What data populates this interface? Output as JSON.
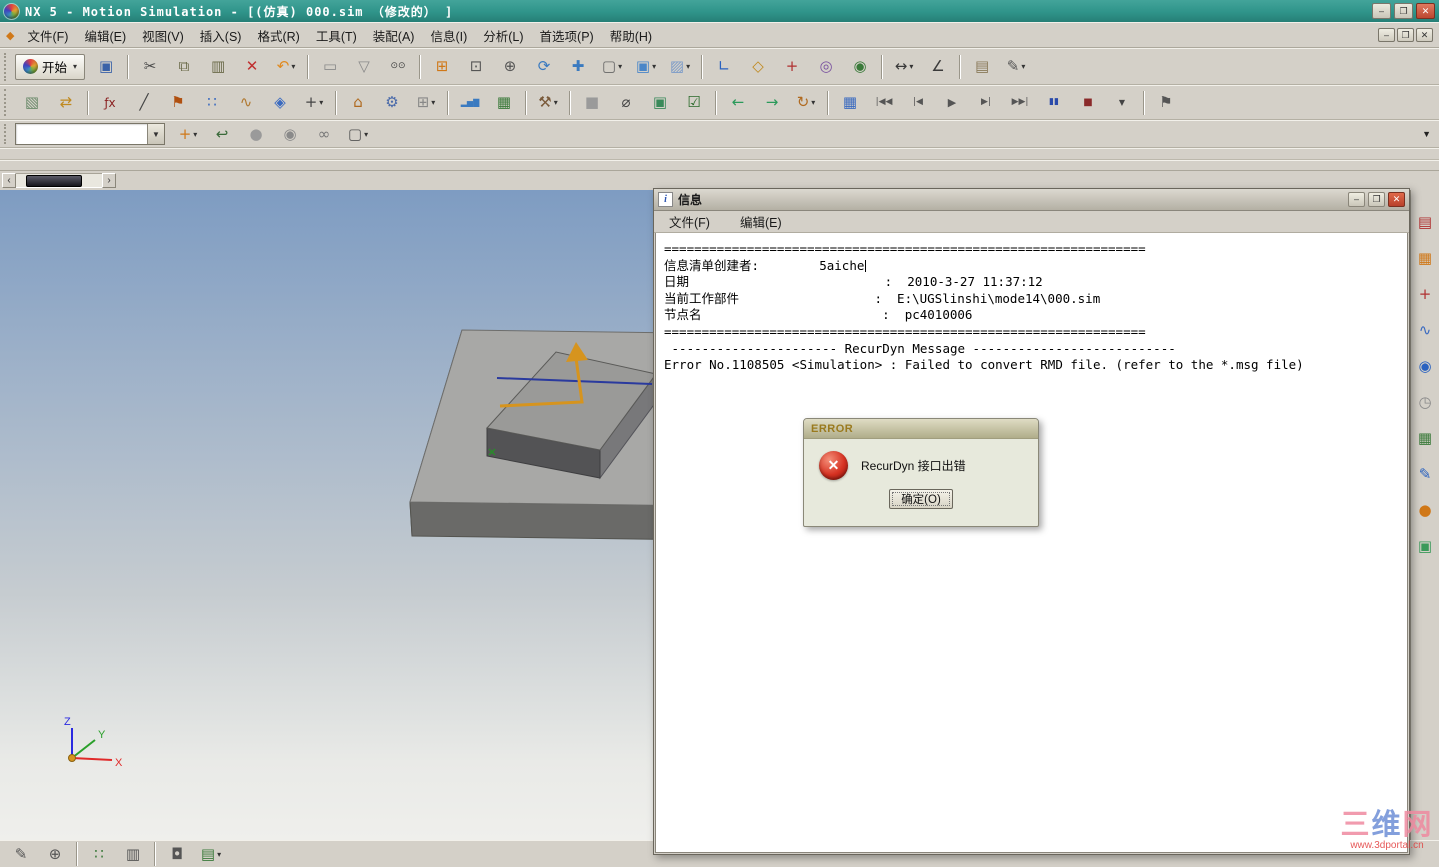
{
  "window": {
    "title": "NX 5 - Motion Simulation - [(仿真) 000.sim （修改的） ]",
    "minimize": "–",
    "restore": "❐",
    "close": "✕"
  },
  "menubar": {
    "items": [
      "文件(F)",
      "编辑(E)",
      "视图(V)",
      "插入(S)",
      "格式(R)",
      "工具(T)",
      "装配(A)",
      "信息(I)",
      "分析(L)",
      "首选项(P)",
      "帮助(H)"
    ],
    "minimize": "–",
    "restore": "❐",
    "close": "✕"
  },
  "toolbar1": {
    "start_label": "开始",
    "dropdown_glyph": "▾",
    "icons": [
      {
        "name": "save-icon",
        "glyph": "▣",
        "color": "#3a62a8"
      },
      {
        "sep": true
      },
      {
        "name": "cut-icon",
        "glyph": "✂",
        "color": "#4a4a4a"
      },
      {
        "name": "copy-icon",
        "glyph": "⧉",
        "color": "#6b6b4a"
      },
      {
        "name": "paste-icon",
        "glyph": "▥",
        "color": "#6b6b4a"
      },
      {
        "name": "delete-icon",
        "glyph": "✕",
        "color": "#c03030"
      },
      {
        "name": "undo-icon",
        "glyph": "↶",
        "color": "#e08a20",
        "arrow": true
      },
      {
        "sep": true
      },
      {
        "name": "sheet-icon",
        "glyph": "▭",
        "color": "#8a8a8a"
      },
      {
        "name": "filter-icon",
        "glyph": "▽",
        "color": "#8a8a8a"
      },
      {
        "name": "glasses-icon",
        "glyph": "⊙⊙",
        "color": "#444444",
        "size": 9
      },
      {
        "sep": true
      },
      {
        "name": "fit-view-icon",
        "glyph": "⊞",
        "color": "#d07818"
      },
      {
        "name": "zoom-window-icon",
        "glyph": "⊡",
        "color": "#555555"
      },
      {
        "name": "zoom-icon",
        "glyph": "⊕",
        "color": "#555555"
      },
      {
        "name": "rotate-view-icon",
        "glyph": "⟳",
        "color": "#3a7ac0"
      },
      {
        "name": "pan-icon",
        "glyph": "✚",
        "color": "#3a7ac0"
      },
      {
        "name": "wireframe-icon",
        "glyph": "▢",
        "color": "#666666",
        "arrow": true
      },
      {
        "name": "shaded-view-icon",
        "glyph": "▣",
        "color": "#4a86c8",
        "arrow": true
      },
      {
        "name": "rendered-view-icon",
        "glyph": "▨",
        "color": "#7a9ac8",
        "arrow": true
      },
      {
        "sep": true
      },
      {
        "name": "csys-icon",
        "glyph": "∟",
        "color": "#2a62c0"
      },
      {
        "name": "datum-plane-icon",
        "glyph": "◇",
        "color": "#c08a20"
      },
      {
        "name": "point-constructor-icon",
        "glyph": "+",
        "color": "#b03030"
      },
      {
        "name": "orient-view-icon",
        "glyph": "◎",
        "color": "#7a52a0"
      },
      {
        "name": "show-hide-icon",
        "glyph": "◉",
        "color": "#3a7a3a"
      },
      {
        "sep": true
      },
      {
        "name": "measure-distance-icon",
        "glyph": "↔",
        "color": "#3a3a3a",
        "arrow": true
      },
      {
        "name": "measure-angle-icon",
        "glyph": "∠",
        "color": "#3a3a3a"
      },
      {
        "sep": true
      },
      {
        "name": "ruler-icon",
        "glyph": "▤",
        "color": "#8a7a5a"
      },
      {
        "name": "annotation-icon",
        "glyph": "✎",
        "color": "#555555",
        "arrow": true
      }
    ]
  },
  "toolbar2": {
    "icons": [
      {
        "name": "part-window-icon",
        "glyph": "▧",
        "color": "#6a8a6a"
      },
      {
        "name": "transform-icon",
        "glyph": "⇄",
        "color": "#c08a20"
      },
      {
        "sep": true
      },
      {
        "name": "expression-icon",
        "glyph": "ƒx",
        "color": "#8a2020",
        "size": 12
      },
      {
        "name": "line-icon",
        "glyph": "╱",
        "color": "#444444"
      },
      {
        "name": "flag-icon",
        "glyph": "⚑",
        "color": "#b05010"
      },
      {
        "name": "pattern-icon",
        "glyph": "∷",
        "color": "#3a6ac0"
      },
      {
        "name": "spring-icon",
        "glyph": "∿",
        "color": "#b07830"
      },
      {
        "name": "marker-icon",
        "glyph": "◈",
        "color": "#3a6ac0"
      },
      {
        "name": "point-icon",
        "glyph": "+",
        "color": "#444444",
        "arrow": true
      },
      {
        "sep": true
      },
      {
        "name": "home-icon",
        "glyph": "⌂",
        "color": "#b06a20"
      },
      {
        "name": "mechanism-icon",
        "glyph": "⚙",
        "color": "#4a6aaa"
      },
      {
        "name": "window-icon",
        "glyph": "⊞",
        "color": "#888888",
        "arrow": true
      },
      {
        "sep": true
      },
      {
        "name": "graph-icon",
        "glyph": "▂▅▇",
        "color": "#3a7ac0",
        "size": 8
      },
      {
        "name": "spreadsheet-icon",
        "glyph": "▦",
        "color": "#3a7a3a"
      },
      {
        "sep": true
      },
      {
        "name": "tools-icon",
        "glyph": "⚒",
        "color": "#7a5a3a",
        "arrow": true
      },
      {
        "sep": true
      },
      {
        "name": "solid-icon",
        "glyph": "■",
        "color": "#9a9a9a"
      },
      {
        "name": "locate-icon",
        "glyph": "⌀",
        "color": "#444444"
      },
      {
        "name": "image-icon",
        "glyph": "▣",
        "color": "#3a8a5a"
      },
      {
        "name": "grid-check-icon",
        "glyph": "☑",
        "color": "#2a6a2a"
      },
      {
        "sep": true
      },
      {
        "name": "back-icon",
        "glyph": "←",
        "color": "#2a9a5a"
      },
      {
        "name": "forward-icon",
        "glyph": "→",
        "color": "#2a9a5a"
      },
      {
        "name": "reorient-icon",
        "glyph": "↻",
        "color": "#b06a20",
        "arrow": true
      },
      {
        "sep": true
      },
      {
        "name": "solve-icon",
        "glyph": "▦",
        "color": "#3a6ac0"
      },
      {
        "name": "to-start-icon",
        "glyph": "|◀◀",
        "color": "#555555",
        "size": 9
      },
      {
        "name": "step-back-icon",
        "glyph": "|◀",
        "color": "#555555",
        "size": 9
      },
      {
        "name": "play-icon",
        "glyph": "▶",
        "color": "#555555",
        "size": 11
      },
      {
        "name": "step-forward-icon",
        "glyph": "▶|",
        "color": "#555555",
        "size": 9
      },
      {
        "name": "to-end-icon",
        "glyph": "▶▶|",
        "color": "#555555",
        "size": 9
      },
      {
        "name": "pause-icon",
        "glyph": "▮▮",
        "color": "#2a4aaa",
        "size": 9
      },
      {
        "name": "stop-icon",
        "glyph": "■",
        "color": "#8a2a2a",
        "size": 10
      },
      {
        "name": "speed-dropdown-icon",
        "glyph": "▼",
        "color": "#444444",
        "size": 8
      },
      {
        "sep": true
      },
      {
        "name": "finish-flag-icon",
        "glyph": "⚑",
        "color": "#555555"
      }
    ]
  },
  "selection_bar": {
    "filter_value": "",
    "combo_arrow": "▼",
    "overflow_glyph": "▼",
    "icons": [
      {
        "name": "snap-add-icon",
        "glyph": "+",
        "color": "#d07818",
        "arrow": true
      },
      {
        "name": "undo-selection-icon",
        "glyph": "↩",
        "color": "#3a6a3a"
      },
      {
        "name": "ball-icon",
        "glyph": "●",
        "color": "#9a9a9a"
      },
      {
        "name": "ball-arrow-icon",
        "glyph": "◉",
        "color": "#8a8a8a"
      },
      {
        "name": "chain-icon",
        "glyph": "∞",
        "color": "#777777"
      },
      {
        "name": "rect-select-icon",
        "glyph": "▢",
        "color": "#555555",
        "arrow": true
      }
    ]
  },
  "right_toolbar": {
    "icons": [
      {
        "name": "simulation-navigator-icon",
        "glyph": "▤",
        "color": "#b03030"
      },
      {
        "name": "grid-snap-icon",
        "glyph": "▦",
        "color": "#d07818"
      },
      {
        "name": "marker-tool-icon",
        "glyph": "+",
        "color": "#b03030"
      },
      {
        "name": "graph-results-icon",
        "glyph": "∿",
        "color": "#3a6ac0"
      },
      {
        "name": "web-browser-icon",
        "glyph": "◉",
        "color": "#2a62c0"
      },
      {
        "name": "history-icon",
        "glyph": "◷",
        "color": "#8a8a8a"
      },
      {
        "name": "spreadsheet-tool-icon",
        "glyph": "▦",
        "color": "#3a7a3a"
      },
      {
        "name": "notes-icon",
        "glyph": "✎",
        "color": "#2a62c0"
      },
      {
        "name": "roles-icon",
        "glyph": "●",
        "color": "#d07818"
      },
      {
        "name": "materials-icon",
        "glyph": "▣",
        "color": "#3a9a5a"
      }
    ]
  },
  "bottom_toolbar": {
    "icons": [
      {
        "name": "edit-object-display-icon",
        "glyph": "✎",
        "color": "#555555"
      },
      {
        "name": "fit-zoom-icon",
        "glyph": "⊕",
        "color": "#555555"
      },
      {
        "sep": true
      },
      {
        "name": "snap-points-icon",
        "glyph": "∷",
        "color": "#3a7a3a"
      },
      {
        "name": "tile-windows-icon",
        "glyph": "▥",
        "color": "#555555"
      },
      {
        "sep": true
      },
      {
        "name": "lock-icon",
        "glyph": "◘",
        "color": "#555555"
      },
      {
        "name": "layer-settings-icon",
        "glyph": "▤",
        "color": "#3a7a3a",
        "arrow": true
      }
    ]
  },
  "mini_scroll": {
    "left": "‹",
    "right": "›"
  },
  "viewport": {
    "axis_x": "X",
    "axis_y": "Y",
    "axis_z": "Z"
  },
  "info_window": {
    "title": "信息",
    "icon": "i",
    "menu": [
      "文件(F)",
      "编辑(E)"
    ],
    "minimize": "–",
    "restore": "❐",
    "close": "✕",
    "lines": [
      "================================================================",
      "信息清单创建者:        5aiche",
      "日期                          :  2010-3-27 11:37:12",
      "当前工作部件                  :  E:\\UGSlinshi\\mode14\\000.sim",
      "节点名                        :  pc4010006",
      "================================================================",
      " ---------------------- RecurDyn Message ---------------------------",
      "Error No.1108505 <Simulation> : Failed to convert RMD file. (refer to the *.msg file)"
    ]
  },
  "error_dialog": {
    "title": "ERROR",
    "icon_glyph": "✕",
    "message": "RecurDyn 接口出错",
    "ok": "确定(O)"
  },
  "watermark": {
    "char1": "三",
    "char2": "维",
    "char3": "网",
    "subtitle": "www.3dportal.cn"
  }
}
